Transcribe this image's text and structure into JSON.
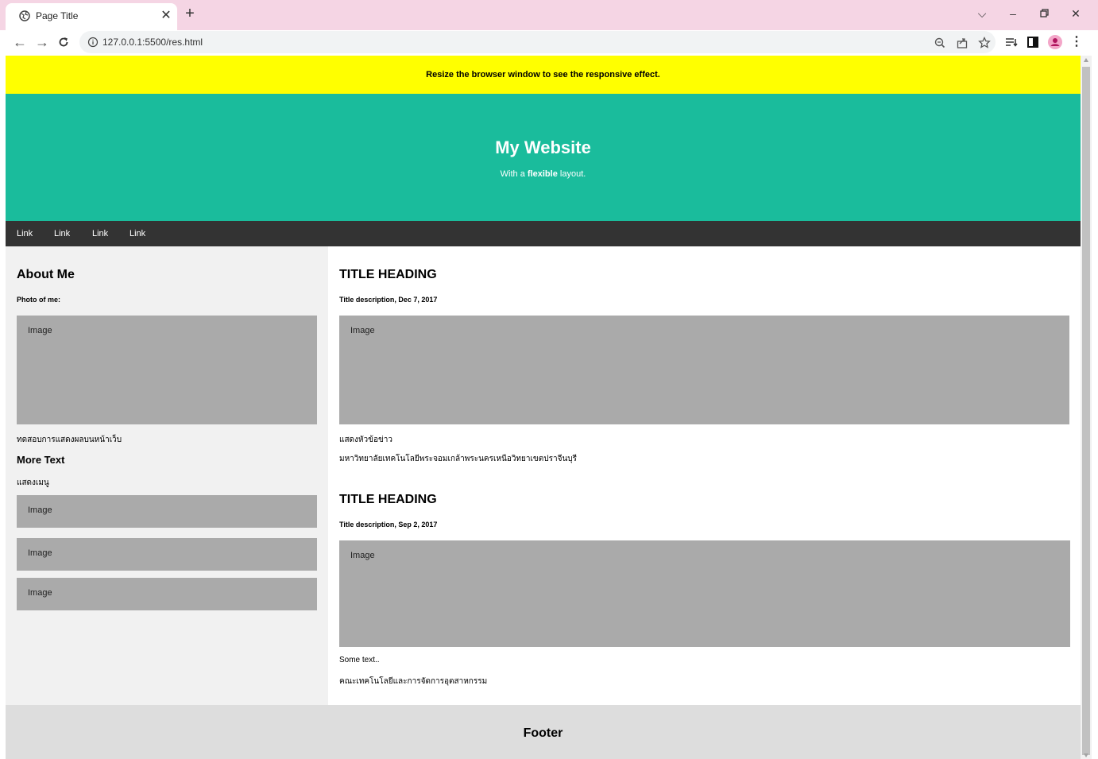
{
  "browser": {
    "tab_title": "Page Title",
    "url": "127.0.0.1:5500/res.html"
  },
  "notice": "Resize the browser window to see the responsive effect.",
  "header": {
    "title": "My Website",
    "subtitle_before": "With a",
    "subtitle_bold": "flexible",
    "subtitle_after": "layout."
  },
  "nav": {
    "links": [
      "Link",
      "Link",
      "Link",
      "Link"
    ]
  },
  "side": {
    "about_heading": "About Me",
    "photo_label": "Photo of me:",
    "photo_image": "Image",
    "caption": "ทดสอบการแสดงผลบนหน้าเว็บ",
    "more_heading": "More Text",
    "menu_text": "แสดงเมนู",
    "images": [
      "Image",
      "Image",
      "Image"
    ]
  },
  "main": {
    "posts": [
      {
        "heading": "TITLE HEADING",
        "description": "Title description, Dec 7, 2017",
        "image": "Image",
        "line1": "แสดงหัวข้อข่าว",
        "line2": "มหาวิทยาลัยเทคโนโลยีพระจอมเกล้าพระนครเหนือวิทยาเขตปราจีนบุรี"
      },
      {
        "heading": "TITLE HEADING",
        "description": "Title description, Sep 2, 2017",
        "image": "Image",
        "line1": "Some text..",
        "line2": "คณะเทคโนโลยีและการจัดการอุตสาหกรรม"
      }
    ]
  },
  "footer": "Footer",
  "colors": {
    "tabstrip": "#f5d5e4",
    "notice": "#ffff00",
    "header": "#1abc9c",
    "navbar": "#333333",
    "side": "#f1f1f1",
    "image": "#aaaaaa",
    "footer": "#dddddd"
  },
  "icons": [
    "globe-icon",
    "close-icon",
    "plus-icon",
    "chevron-down-icon",
    "minimize-icon",
    "restore-icon",
    "back-icon",
    "forward-icon",
    "reload-icon",
    "info-icon",
    "zoom-icon",
    "share-icon",
    "star-icon",
    "reading-list-icon",
    "side-panel-icon",
    "profile-icon",
    "menu-icon"
  ]
}
